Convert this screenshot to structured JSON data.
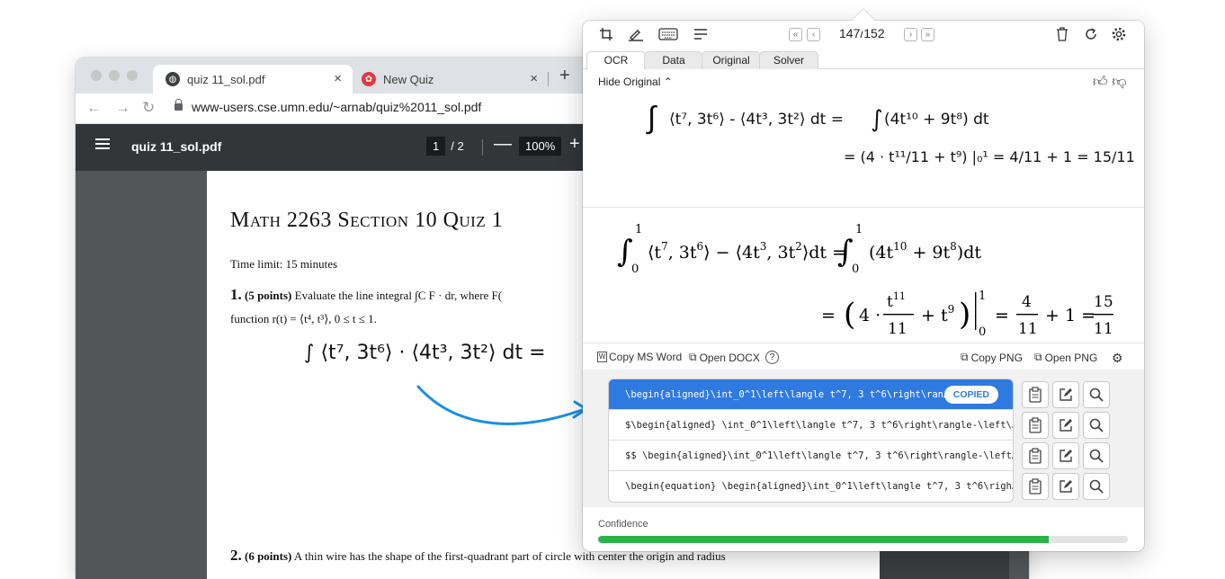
{
  "browser": {
    "tabs": [
      {
        "title": "quiz 11_sol.pdf",
        "close": "×"
      },
      {
        "title": "New Quiz",
        "close": "×"
      }
    ],
    "new_tab": "+",
    "url": "www-users.cse.umn.edu/~arnab/quiz%2011_sol.pdf"
  },
  "pdf_viewer": {
    "filename": "quiz 11_sol.pdf",
    "page_current": "1",
    "page_total": "/ 2",
    "zoom": "100%",
    "zoom_out": "—",
    "zoom_in": "+"
  },
  "pdf_page": {
    "title": "Math 2263 Section 10 Quiz 1",
    "time_limit": "Time limit: 15 minutes",
    "q1_number": "1.",
    "q1_points": "(5 points)",
    "q1_text": "Evaluate the line integral ∫C F · dr, where F(",
    "q1_text2": "function r(t) = ⟨t⁴, t³⟩, 0 ≤ t ≤ 1.",
    "q1_handwriting": "∫ ⟨t⁷, 3t⁶⟩ · ⟨4t³, 3t²⟩ dt  =",
    "q2_number": "2.",
    "q2_points": "(6 points)",
    "q2_text": "A thin wire has the shape of the first-quadrant part of circle with center the origin and radius"
  },
  "app": {
    "counter": "147/152",
    "nav": {
      "first": "«",
      "prev": "‹",
      "next": "›",
      "last": "»"
    },
    "tabs": [
      "OCR",
      "Data",
      "Original",
      "Solver"
    ],
    "active_tab": "OCR",
    "hide_original": "Hide Original",
    "original_handwriting": {
      "line1_left": "⟨t⁷, 3t⁶⟩ - ⟨4t³, 3t²⟩ dt  =",
      "line1_right": "(4t¹⁰ + 9t⁸) dt",
      "line2": "= (4 · t¹¹/11 + t⁹) |₀¹ = 4/11 + 1 = 15/11"
    },
    "rendered_math": {
      "line1": "∫₀¹ ⟨t⁷, 3t⁶⟩ − ⟨4t³, 3t²⟩dt = ∫₀¹ (4t¹⁰ + 9t⁸)dt",
      "line2": "= (4 · t¹¹/11 + t⁹)|₀¹ = 4/11 + 1 = 15/11"
    },
    "actions": {
      "copy_word": "Copy MS Word",
      "open_docx": "Open DOCX",
      "copy_png": "Copy PNG",
      "open_png": "Open PNG"
    },
    "results": [
      {
        "text": "\\begin{aligned}\\int_0^1\\left\\langle t^7, 3 t^6\\right\\ran…",
        "badge": "COPIED"
      },
      {
        "text": "$\\begin{aligned} \\int_0^1\\left\\langle t^7, 3 t^6\\right\\rangle-\\left\\…"
      },
      {
        "text": "$$ \\begin{aligned}\\int_0^1\\left\\langle t^7, 3 t^6\\right\\rangle-\\left…"
      },
      {
        "text": "\\begin{equation} \\begin{aligned}\\int_0^1\\left\\langle t^7, 3 t^6\\righ…"
      }
    ],
    "confidence_label": "Confidence",
    "confidence_value": 0.85,
    "colors": {
      "accent": "#2f7ae0",
      "confidence": "#2ab34a",
      "arrow": "#1a8fe0"
    }
  }
}
